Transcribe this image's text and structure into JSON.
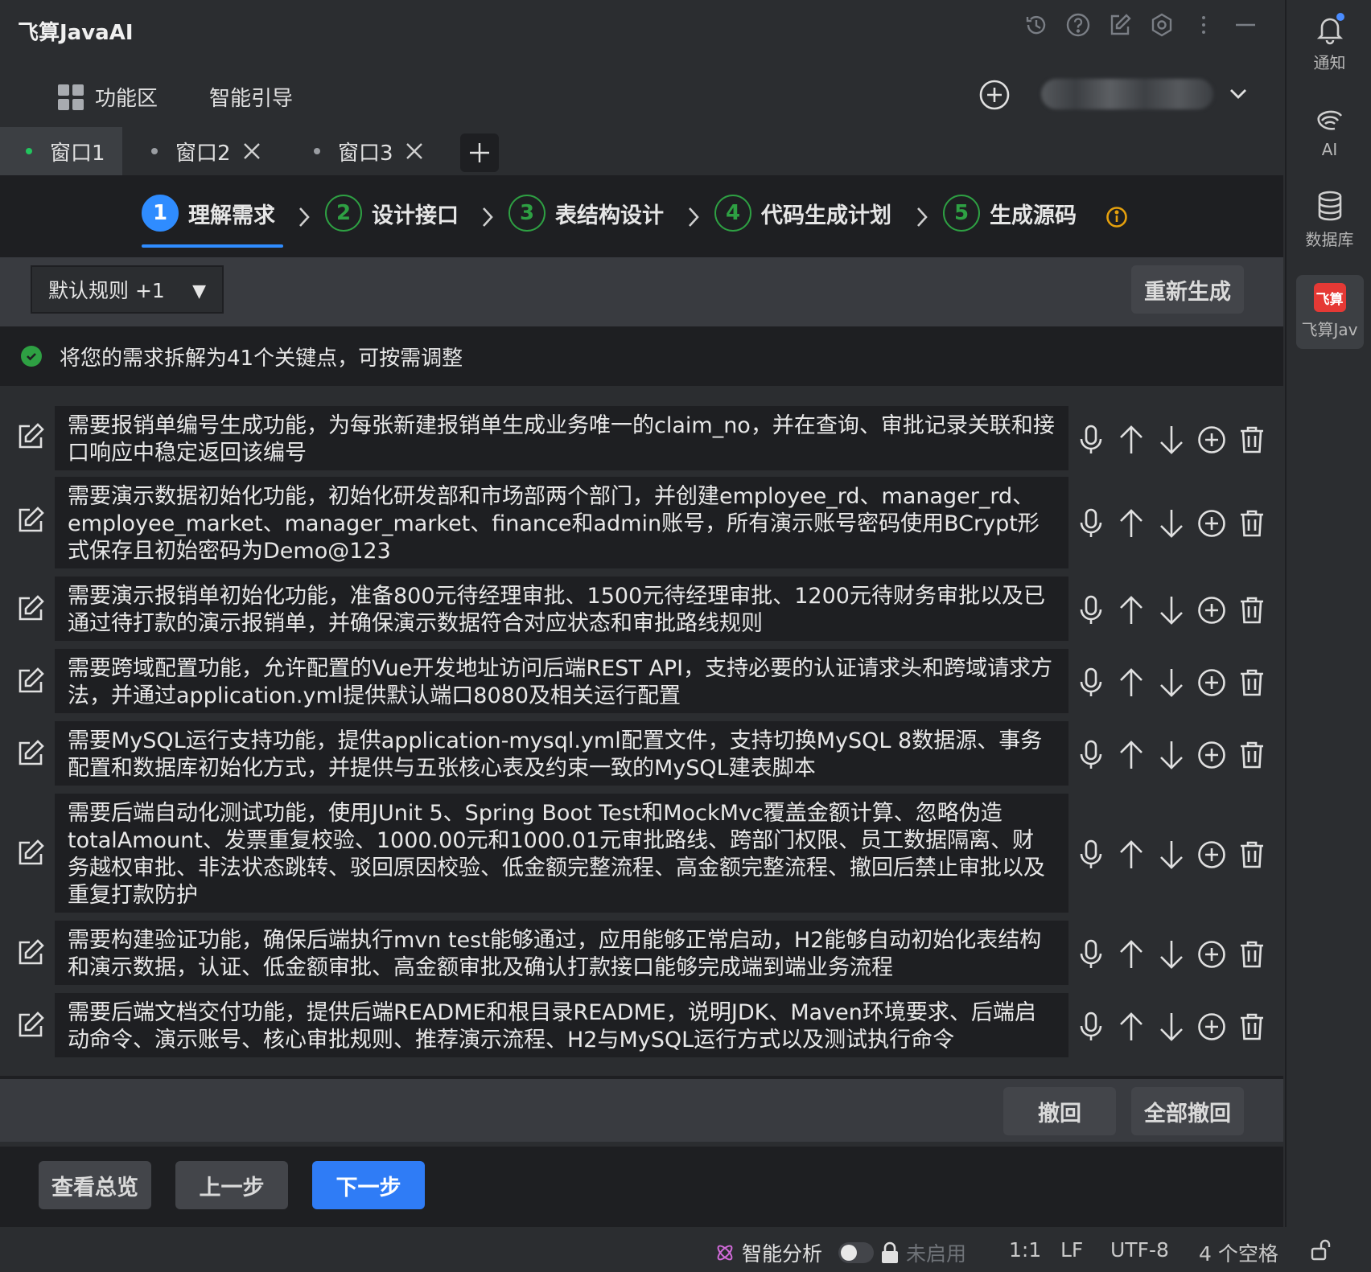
{
  "app": {
    "title": "飞算JavaAI"
  },
  "nav": {
    "func_label": "功能区",
    "guide_label": "智能引导"
  },
  "tabs": [
    {
      "label": "窗口1",
      "active": true
    },
    {
      "label": "窗口2",
      "active": false
    },
    {
      "label": "窗口3",
      "active": false
    }
  ],
  "steps": [
    {
      "num": "1",
      "label": "理解需求",
      "active": true
    },
    {
      "num": "2",
      "label": "设计接口",
      "active": false
    },
    {
      "num": "3",
      "label": "表结构设计",
      "active": false
    },
    {
      "num": "4",
      "label": "代码生成计划",
      "active": false
    },
    {
      "num": "5",
      "label": "生成源码",
      "active": false
    }
  ],
  "toolbar": {
    "rule_select": "默认规则 +1",
    "regenerate": "重新生成"
  },
  "summary": {
    "text": "将您的需求拆解为41个关键点，可按需调整"
  },
  "requirements": [
    "需要报销单编号生成功能，为每张新建报销单生成业务唯一的claim_no，并在查询、审批记录关联和接口响应中稳定返回该编号",
    "需要演示数据初始化功能，初始化研发部和市场部两个部门，并创建employee_rd、manager_rd、employee_market、manager_market、finance和admin账号，所有演示账号密码使用BCrypt形式保存且初始密码为Demo@123",
    "需要演示报销单初始化功能，准备800元待经理审批、1500元待经理审批、1200元待财务审批以及已通过待打款的演示报销单，并确保演示数据符合对应状态和审批路线规则",
    "需要跨域配置功能，允许配置的Vue开发地址访问后端REST API，支持必要的认证请求头和跨域请求方法，并通过application.yml提供默认端口8080及相关运行配置",
    "需要MySQL运行支持功能，提供application-mysql.yml配置文件，支持切换MySQL 8数据源、事务配置和数据库初始化方式，并提供与五张核心表及约束一致的MySQL建表脚本",
    "需要后端自动化测试功能，使用JUnit 5、Spring Boot Test和MockMvc覆盖金额计算、忽略伪造totalAmount、发票重复校验、1000.00元和1000.01元审批路线、跨部门权限、员工数据隔离、财务越权审批、非法状态跳转、驳回原因校验、低金额完整流程、高金额完整流程、撤回后禁止审批以及重复打款防护",
    "需要构建验证功能，确保后端执行mvn test能够通过，应用能够正常启动，H2能够自动初始化表结构和演示数据，认证、低金额审批、高金额审批及确认打款接口能够完成端到端业务流程",
    "需要后端文档交付功能，提供后端README和根目录README，说明JDK、Maven环境要求、后端启动命令、演示账号、核心审批规则、推荐演示流程、H2与MySQL运行方式以及测试执行命令"
  ],
  "undo": {
    "undo": "撤回",
    "undo_all": "全部撤回"
  },
  "footer": {
    "overview": "查看总览",
    "prev": "上一步",
    "next": "下一步"
  },
  "status": {
    "smart": "智能分析",
    "disabled": "未启用",
    "position": "1:1",
    "line_ending": "LF",
    "encoding": "UTF-8",
    "indent": "4 个空格"
  },
  "rightbar": {
    "notify": "通知",
    "ai": "AI",
    "db": "数据库",
    "feisuan": "飞算Jav",
    "logo_text": "飞算"
  },
  "colors": {
    "accent": "#2f7cf6",
    "success": "#2ea043",
    "warning": "#e5a00d"
  }
}
